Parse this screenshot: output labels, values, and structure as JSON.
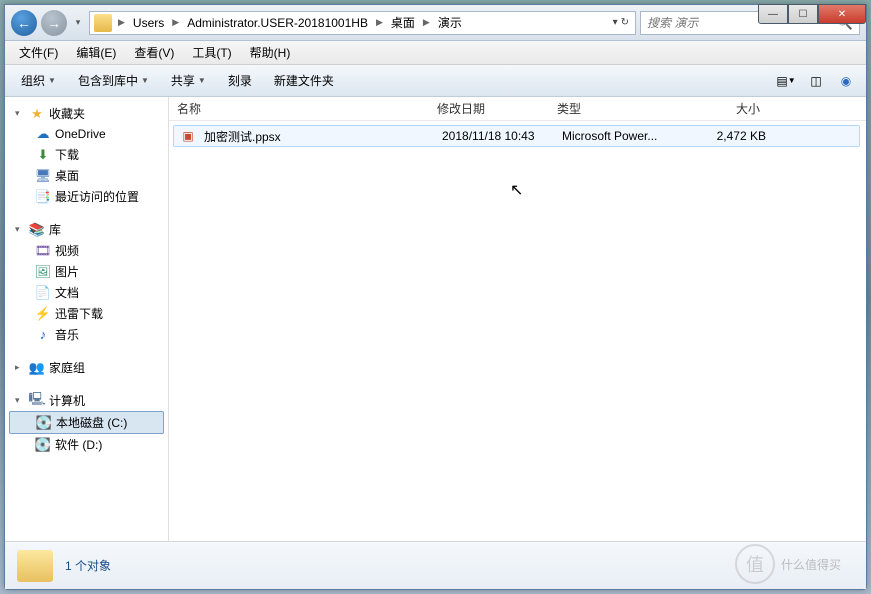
{
  "titlebar": {
    "min": "—",
    "max": "☐",
    "close": "✕"
  },
  "nav": {
    "back": "←",
    "forward": "→"
  },
  "breadcrumb": [
    "Users",
    "Administrator.USER-20181001HB",
    "桌面",
    "演示"
  ],
  "address_actions": {
    "dropdown": "▾",
    "refresh": "↻"
  },
  "search": {
    "placeholder": "搜索 演示"
  },
  "menu": {
    "file": "文件(F)",
    "edit": "编辑(E)",
    "view": "查看(V)",
    "tools": "工具(T)",
    "help": "帮助(H)"
  },
  "toolbar": {
    "organize": "组织",
    "include": "包含到库中",
    "share": "共享",
    "burn": "刻录",
    "newfolder": "新建文件夹"
  },
  "columns": {
    "name": "名称",
    "date": "修改日期",
    "type": "类型",
    "size": "大小"
  },
  "file": {
    "name": "加密测试.ppsx",
    "date": "2018/11/18 10:43",
    "type": "Microsoft Power...",
    "size": "2,472 KB"
  },
  "tree": {
    "favorites": "收藏夹",
    "onedrive": "OneDrive",
    "downloads": "下载",
    "desktop": "桌面",
    "recent": "最近访问的位置",
    "library": "库",
    "video": "视频",
    "pictures": "图片",
    "documents": "文档",
    "thunder": "迅雷下载",
    "music": "音乐",
    "homegroup": "家庭组",
    "computer": "计算机",
    "diskc": "本地磁盘 (C:)",
    "diskd": "软件 (D:)"
  },
  "status": {
    "count": "1 个对象"
  },
  "watermark": {
    "text": "什么值得买",
    "glyph": "值"
  }
}
